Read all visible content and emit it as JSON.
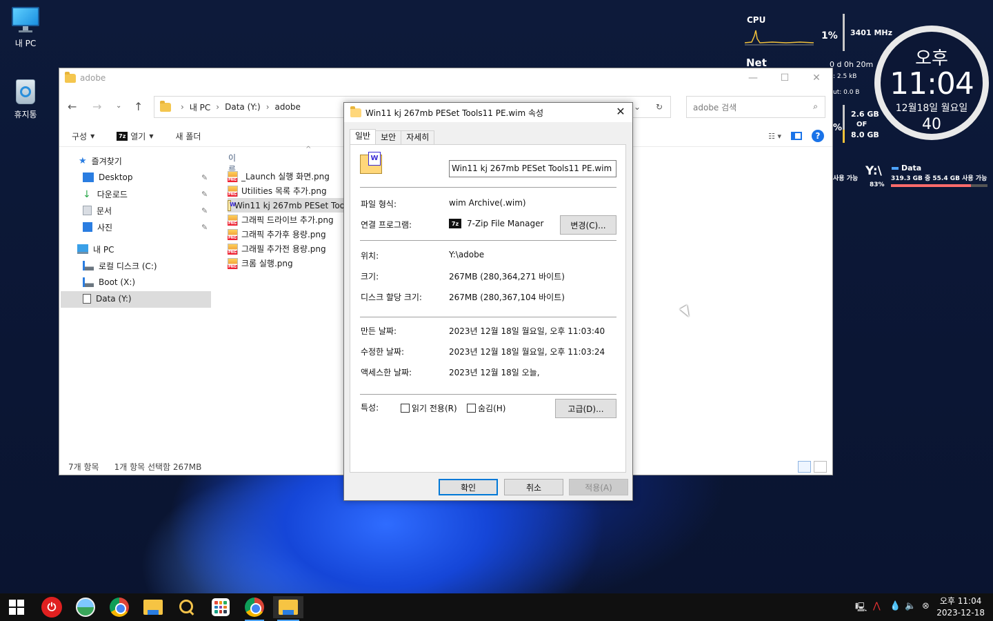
{
  "desktop": {
    "icons": [
      {
        "label": "내 PC",
        "icon": "monitor-icon"
      },
      {
        "label": "휴지통",
        "icon": "recycle-bin-icon"
      }
    ]
  },
  "widgets": {
    "cpu_label": "CPU",
    "cpu_percent": "1%",
    "cpu_freq": "3401 MHz",
    "net_label": "Net",
    "uptime": "0 d 0h 20m",
    "net_in": ": 2.5 kB",
    "net_out": "ut: 0.0 B",
    "mem_used": "2.6 GB",
    "mem_of": "OF",
    "mem_total": "8.0 GB",
    "mem_pct_fragment": "%",
    "clock_ampm": "오후",
    "clock_time": "11:04",
    "clock_date": "12월18일 월요일",
    "clock_seconds": "40",
    "drive_left_fragment": "사용 가능",
    "drive_letter": "Y:\\",
    "drive_pct": "83%",
    "drive_name": "Data",
    "drive_usage": "319.3 GB 중 55.4 GB 사용 가능",
    "drive_used_fraction": 0.83
  },
  "explorer": {
    "title": "adobe",
    "breadcrumb": [
      "내 PC",
      "Data (Y:)",
      "adobe"
    ],
    "search_placeholder": "adobe 검색",
    "commands": {
      "organize": "구성",
      "open": "열기",
      "new_folder": "새 폴더"
    },
    "sidebar": {
      "quick_access": "즐겨찾기",
      "items": [
        "Desktop",
        "다운로드",
        "문서",
        "사진"
      ],
      "this_pc": "내 PC",
      "drives": [
        "로컬 디스크 (C:)",
        "Boot (X:)",
        "Data (Y:)"
      ]
    },
    "column_name": "이름",
    "files": [
      {
        "name": "_Launch 실행 화면.png",
        "type": "png"
      },
      {
        "name": "Utilities 목록 추가.png",
        "type": "png"
      },
      {
        "name": "Win11 kj 267mb PESet Too",
        "type": "wim"
      },
      {
        "name": "그래픽 드라이브 추가.png",
        "type": "png"
      },
      {
        "name": "그래픽 추가후 용량.png",
        "type": "png"
      },
      {
        "name": "그래필 추가전 용량.png",
        "type": "png"
      },
      {
        "name": "크롬 실행.png",
        "type": "png"
      }
    ],
    "status_count": "7개 항목",
    "status_selected": "1개 항목 선택함 267MB"
  },
  "dialog": {
    "title": "Win11 kj 267mb PESet Tools11 PE.wim 속성",
    "tabs": [
      "일반",
      "보안",
      "자세히"
    ],
    "filename": "Win11 kj 267mb PESet Tools11 PE.wim",
    "labels": {
      "type": "파일 형식:",
      "opens_with": "연결 프로그램:",
      "location": "위치:",
      "size": "크기:",
      "size_on_disk": "디스크 할당 크기:",
      "created": "만든 날짜:",
      "modified": "수정한 날짜:",
      "accessed": "액세스한 날짜:",
      "attributes": "특성:"
    },
    "values": {
      "type": "wim Archive(.wim)",
      "opens_with": "7-Zip File Manager",
      "location": "Y:\\adobe",
      "size": "267MB (280,364,271 바이트)",
      "size_on_disk": "267MB (280,367,104 바이트)",
      "created": "2023년 12월 18일 월요일, 오후 11:03:40",
      "modified": "2023년 12월 18일 월요일, 오후 11:03:24",
      "accessed": "2023년 12월 18일 오늘,"
    },
    "seven_zip_badge": "7z",
    "buttons": {
      "change": "변경(C)...",
      "advanced": "고급(D)...",
      "ok": "확인",
      "cancel": "취소",
      "apply": "적용(A)"
    },
    "checkboxes": {
      "readonly": "읽기 전용(R)",
      "hidden": "숨김(H)"
    }
  },
  "taskbar": {
    "time": "오후 11:04",
    "date": "2023-12-18"
  }
}
